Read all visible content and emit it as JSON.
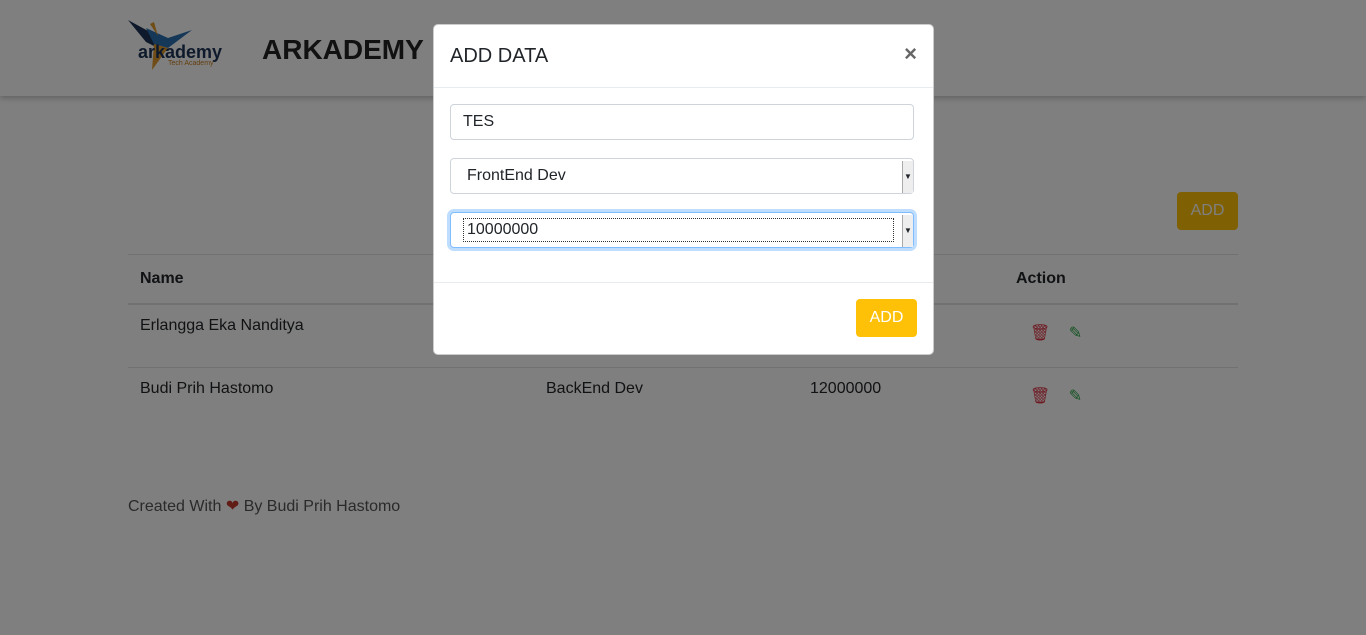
{
  "header": {
    "logo_text": "arkademy",
    "logo_sub": "Tech Academy",
    "title": "ARKADEMY"
  },
  "main": {
    "add_label": "ADD",
    "table": {
      "headers": [
        "Name",
        "",
        "",
        "Action"
      ],
      "rows": [
        {
          "name": "Erlangga Eka Nanditya",
          "position": "",
          "salary": ""
        },
        {
          "name": "Budi Prih Hastomo",
          "position": "BackEnd Dev",
          "salary": "12000000"
        }
      ]
    }
  },
  "footer": {
    "prefix": "Created With",
    "heart": "❤",
    "suffix": "By Budi Prih Hastomo"
  },
  "modal": {
    "title": "ADD DATA",
    "close": "×",
    "name_value": "TES",
    "position_value": "FrontEnd Dev",
    "salary_value": "10000000",
    "add_label": "ADD"
  },
  "colors": {
    "accent": "#ffc107",
    "delete": "#dc3545",
    "edit": "#28a745"
  }
}
